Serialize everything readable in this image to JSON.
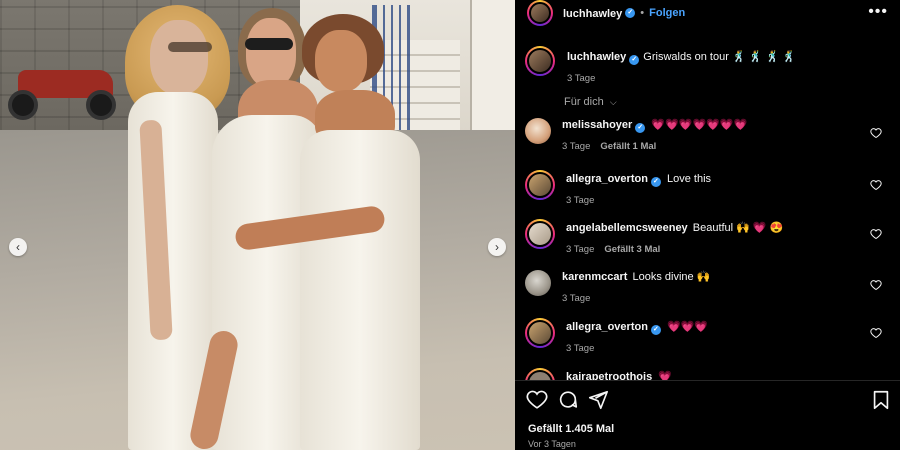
{
  "post": {
    "author": "luchhawley",
    "follow_label": "Folgen",
    "separator": "•",
    "more_label": "•••",
    "caption": "Griswalds on tour 🕺 🕺 🕺 🕺",
    "caption_time": "3 Tage"
  },
  "media": {
    "prev_label": "‹",
    "next_label": "›"
  },
  "filter_label": "Für dich",
  "comments": [
    {
      "user": "melissahoyer",
      "verified": true,
      "text": "💗💗💗💗💗💗💗",
      "time": "3 Tage",
      "likes": "Gefällt 1 Mal"
    },
    {
      "user": "allegra_overton",
      "verified": true,
      "text": "Love this",
      "time": "3 Tage",
      "likes": ""
    },
    {
      "user": "angelabellemcsweeney",
      "verified": false,
      "text": "Beautful 🙌 💗 😍",
      "time": "3 Tage",
      "likes": "Gefällt 3 Mal"
    },
    {
      "user": "karenmccart",
      "verified": false,
      "text": "Looks divine 🙌",
      "time": "3 Tage",
      "likes": ""
    },
    {
      "user": "allegra_overton",
      "verified": true,
      "text": "💗💗💗",
      "time": "3 Tage",
      "likes": ""
    },
    {
      "user": "kairapetroothois",
      "verified": false,
      "text": "💗",
      "time": "",
      "likes": ""
    }
  ],
  "footer": {
    "likes_total": "Gefällt 1.405 Mal",
    "posted_ago": "Vor 3 Tagen"
  },
  "colors": {
    "accent_link": "#4aa4ff",
    "verified": "#3897f0",
    "heart": "#ff3b5c",
    "background": "#000000"
  },
  "icons": [
    "like-heart-icon",
    "comment-icon",
    "share-icon",
    "save-bookmark-icon",
    "verified-badge-icon",
    "more-options-icon",
    "chevron-down-icon"
  ]
}
